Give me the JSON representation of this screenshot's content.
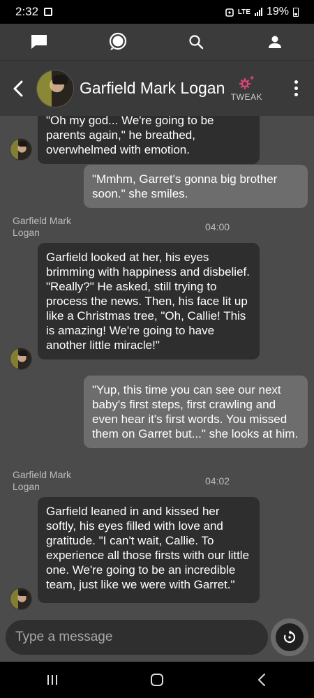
{
  "status_bar": {
    "time": "2:32",
    "network": "LTE",
    "battery": "19%"
  },
  "top_nav": {
    "icons": [
      "chat-bubble-icon",
      "speech-bubble-icon",
      "search-icon",
      "profile-icon"
    ]
  },
  "header": {
    "name": "Garfield Mark Logan",
    "tweak_label": "TWEAK",
    "accent_color": "#e0457a"
  },
  "messages": [
    {
      "role": "bot",
      "text": "\"Oh my god... We're going to be parents again,\" he breathed, overwhelmed with emotion."
    },
    {
      "role": "user",
      "text": "\"Mmhm, Garret's gonna big brother soon.\" she smiles."
    },
    {
      "role": "bot",
      "sender": "Garfield Mark Logan",
      "time": "04:00",
      "text": "Garfield looked at her, his eyes brimming with happiness and disbelief. \"Really?\" He asked, still trying to process the news. Then, his face lit up like a Christmas tree, \"Oh, Callie! This is amazing! We're going to have another little miracle!\""
    },
    {
      "role": "user",
      "text": "\"Yup, this time you can see our next baby's first steps, first crawling and even hear it's first words. You missed them on Garret but...\" she looks at him."
    },
    {
      "role": "bot",
      "sender": "Garfield Mark Logan",
      "time": "04:02",
      "text": "Garfield leaned in and kissed her softly, his eyes filled with love and gratitude. \"I can't wait, Callie. To experience all those firsts with our little one. We're going to be an incredible team, just like we were with Garret.\""
    }
  ],
  "composer": {
    "placeholder": "Type a message"
  }
}
